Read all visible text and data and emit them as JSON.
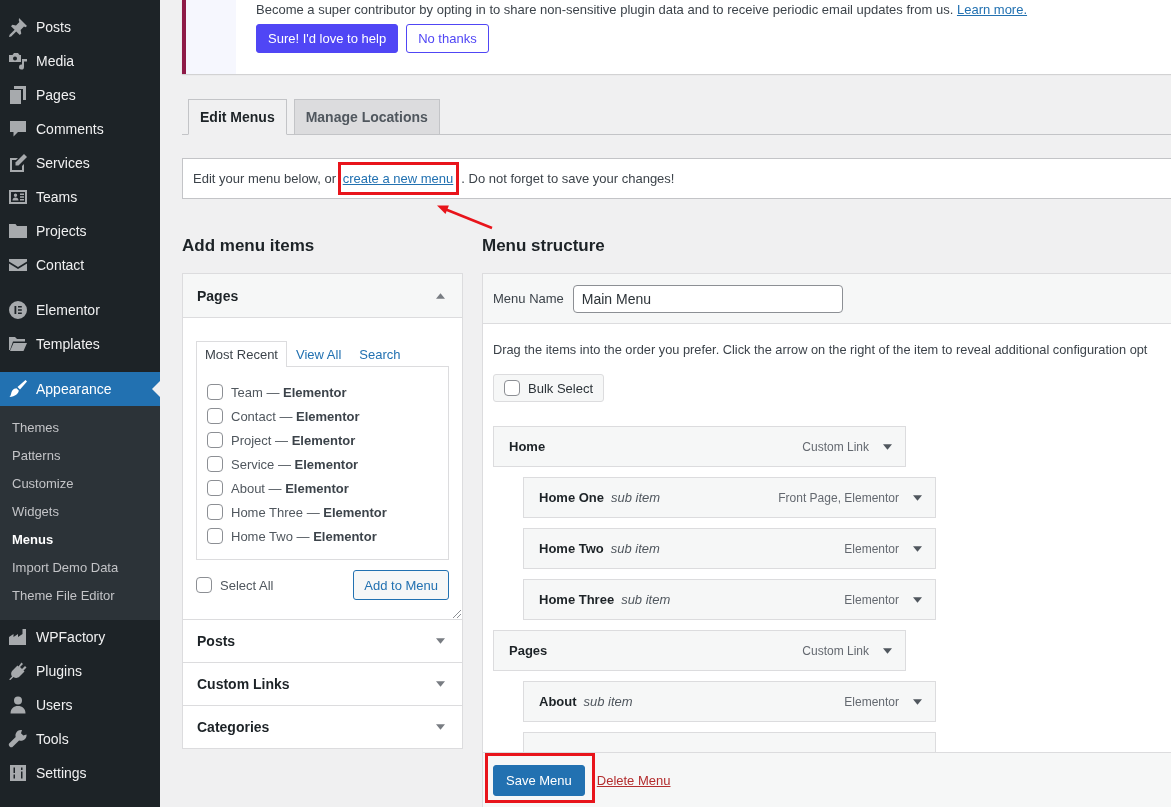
{
  "sidebar": {
    "groups": [
      {
        "items": [
          {
            "label": "Posts",
            "selected": false
          },
          {
            "label": "Media",
            "selected": false
          },
          {
            "label": "Pages",
            "selected": false
          },
          {
            "label": "Comments",
            "selected": false
          },
          {
            "label": "Services",
            "selected": false
          },
          {
            "label": "Teams",
            "selected": false
          },
          {
            "label": "Projects",
            "selected": false
          },
          {
            "label": "Contact",
            "selected": false
          }
        ]
      },
      {
        "items": [
          {
            "label": "Elementor",
            "selected": false
          },
          {
            "label": "Templates",
            "selected": false
          }
        ]
      },
      {
        "items": [
          {
            "label": "Appearance",
            "selected": true,
            "children": [
              {
                "label": "Themes",
                "selected": false
              },
              {
                "label": "Patterns",
                "selected": false
              },
              {
                "label": "Customize",
                "selected": false
              },
              {
                "label": "Widgets",
                "selected": false
              },
              {
                "label": "Menus",
                "selected": true
              },
              {
                "label": "Import Demo Data",
                "selected": false
              },
              {
                "label": "Theme File Editor",
                "selected": false
              }
            ]
          },
          {
            "label": "WPFactory",
            "selected": false
          },
          {
            "label": "Plugins",
            "selected": false
          },
          {
            "label": "Users",
            "selected": false
          },
          {
            "label": "Tools",
            "selected": false
          },
          {
            "label": "Settings",
            "selected": false
          }
        ]
      }
    ]
  },
  "notice": {
    "text": "Become a super contributor by opting in to share non-sensitive plugin data and to receive periodic email updates from us.",
    "link": "Learn more.",
    "buttons": [
      {
        "label": "Sure! I'd love to help",
        "kind": "primary"
      },
      {
        "label": "No thanks",
        "kind": "secondary"
      }
    ]
  },
  "tabs": [
    {
      "label": "Edit Menus",
      "selected": true
    },
    {
      "label": "Manage Locations",
      "selected": false
    }
  ],
  "manage_bar": {
    "before": "Edit your menu below, or ",
    "link": {
      "text": "create a new menu",
      "highlighted": true,
      "arrow": true
    },
    "after": ". Do not forget to save your changes!"
  },
  "add_menu_items": {
    "title": "Add menu items",
    "sections": [
      {
        "title": "Pages",
        "expanded": true,
        "tabs": [
          {
            "label": "Most Recent",
            "selected": true
          },
          {
            "label": "View All",
            "selected": false
          },
          {
            "label": "Search",
            "selected": false
          }
        ],
        "options": [
          {
            "label": "Team — **Elementor**",
            "checked": false
          },
          {
            "label": "Contact — **Elementor**",
            "checked": false
          },
          {
            "label": "Project — **Elementor**",
            "checked": false
          },
          {
            "label": "Service — **Elementor**",
            "checked": false
          },
          {
            "label": "About — **Elementor**",
            "checked": false
          },
          {
            "label": "Home Three — **Elementor**",
            "checked": false
          },
          {
            "label": "Home Two — **Elementor**",
            "checked": false
          }
        ],
        "select_all": {
          "label": "Select All",
          "checked": false
        },
        "button": "Add to Menu"
      },
      {
        "title": "Posts",
        "expanded": false
      },
      {
        "title": "Custom Links",
        "expanded": false
      },
      {
        "title": "Categories",
        "expanded": false
      }
    ]
  },
  "menu_structure": {
    "title": "Menu structure",
    "name_label": "Menu Name",
    "name_value": "Main Menu",
    "instructions": "Drag the items into the order you prefer. Click the arrow on the right of the item to reveal additional configuration opt",
    "bulk_select": {
      "label": "Bulk Select",
      "checked": false
    },
    "items": [
      {
        "title": "Home",
        "type": "Custom Link",
        "children": [
          {
            "title": "Home One",
            "note": "sub item",
            "type": "Front Page, Elementor"
          },
          {
            "title": "Home Two",
            "note": "sub item",
            "type": "Elementor"
          },
          {
            "title": "Home Three",
            "note": "sub item",
            "type": "Elementor"
          }
        ]
      },
      {
        "title": "Pages",
        "type": "Custom Link",
        "children": [
          {
            "title": "About",
            "note": "sub item",
            "type": "Elementor"
          }
        ]
      }
    ],
    "more_below": true,
    "save_button": {
      "label": "Save Menu",
      "highlighted": true
    },
    "delete_link": "Delete Menu"
  }
}
